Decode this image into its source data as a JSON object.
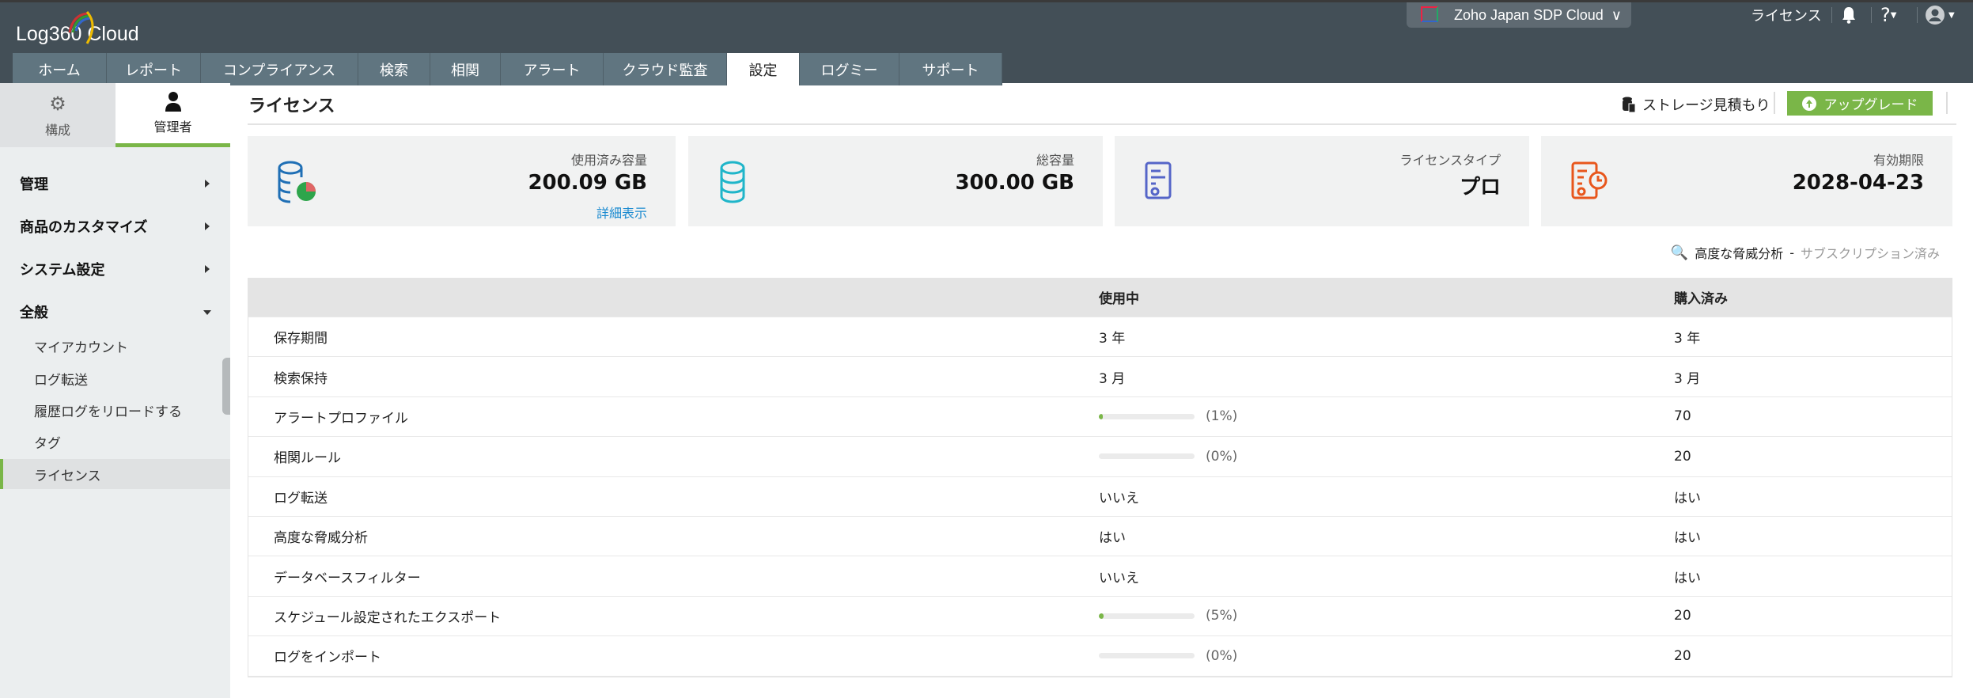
{
  "app": {
    "logo_text": "Log360 Cloud",
    "org_name": "Zoho Japan SDP Cloud",
    "license_link": "ライセンス"
  },
  "tabs": [
    {
      "label": "ホーム"
    },
    {
      "label": "レポート"
    },
    {
      "label": "コンプライアンス"
    },
    {
      "label": "検索"
    },
    {
      "label": "相関"
    },
    {
      "label": "アラート"
    },
    {
      "label": "クラウド監査"
    },
    {
      "label": "設定",
      "active": true
    },
    {
      "label": "ログミー"
    },
    {
      "label": "サポート"
    }
  ],
  "sidebar": {
    "tabs": {
      "config": "構成",
      "admin": "管理者"
    },
    "sections": [
      {
        "label": "管理"
      },
      {
        "label": "商品のカスタマイズ"
      },
      {
        "label": "システム設定"
      },
      {
        "label": "全般"
      }
    ],
    "items": [
      {
        "label": "マイアカウント"
      },
      {
        "label": "ログ転送"
      },
      {
        "label": "履歴ログをリロードする"
      },
      {
        "label": "タグ"
      },
      {
        "label": "ライセンス"
      }
    ]
  },
  "page": {
    "title": "ライセンス",
    "storage_estimate": "ストレージ見積もり",
    "upgrade": "アップグレード"
  },
  "cards": [
    {
      "label": "使用済み容量",
      "value": "200.09 GB",
      "link": "詳細表示"
    },
    {
      "label": "総容量",
      "value": "300.00 GB"
    },
    {
      "label": "ライセンスタイプ",
      "value": "プロ"
    },
    {
      "label": "有効期限",
      "value": "2028-04-23"
    }
  ],
  "threat": {
    "label": "高度な脅威分析",
    "sep": "-",
    "status": "サブスクリプション済み"
  },
  "table": {
    "headers": {
      "name": "",
      "used": "使用中",
      "purchased": "購入済み"
    },
    "rows": [
      {
        "name": "保存期間",
        "used": "3 年",
        "purchased": "3 年"
      },
      {
        "name": "検索保持",
        "used": "3 月",
        "purchased": "3 月"
      },
      {
        "name": "アラートプロファイル",
        "progress": 1,
        "pct": "(1%)",
        "purchased": "70"
      },
      {
        "name": "相関ルール",
        "progress": 0,
        "pct": "(0%)",
        "purchased": "20"
      },
      {
        "name": "ログ転送",
        "used": "いいえ",
        "purchased": "はい"
      },
      {
        "name": "高度な脅威分析",
        "used": "はい",
        "purchased": "はい"
      },
      {
        "name": "データベースフィルター",
        "used": "いいえ",
        "purchased": "はい"
      },
      {
        "name": "スケジュール設定されたエクスポート",
        "progress": 5,
        "pct": "(5%)",
        "purchased": "20"
      },
      {
        "name": "ログをインポート",
        "progress": 0,
        "pct": "(0%)",
        "purchased": "20"
      }
    ]
  },
  "colors": {
    "header": "#434f57",
    "tab": "#607580",
    "accent": "#7ab648",
    "link": "#1a8ad0"
  }
}
